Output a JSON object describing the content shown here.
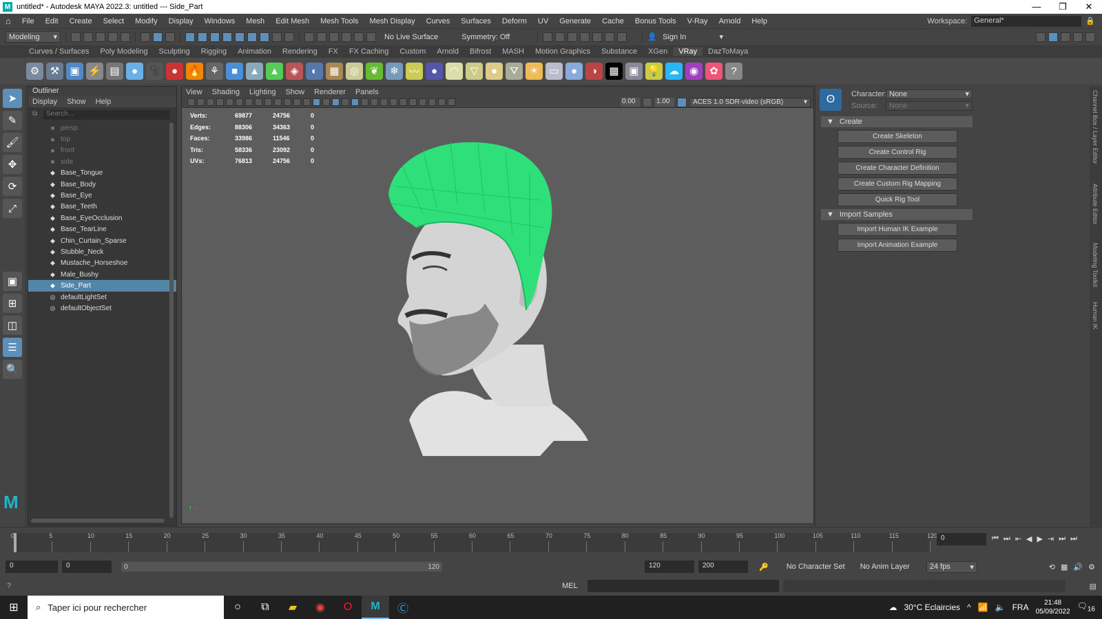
{
  "window": {
    "title": "untitled* - Autodesk MAYA 2022.3: untitled   ---   Side_Part",
    "min": "—",
    "restore": "❐",
    "close": "✕"
  },
  "menu": [
    "File",
    "Edit",
    "Create",
    "Select",
    "Modify",
    "Display",
    "Windows",
    "Mesh",
    "Edit Mesh",
    "Mesh Tools",
    "Mesh Display",
    "Curves",
    "Surfaces",
    "Deform",
    "UV",
    "Generate",
    "Cache",
    "Bonus Tools",
    "V-Ray",
    "Arnold",
    "Help"
  ],
  "workspace": {
    "label": "Workspace:",
    "value": "General*"
  },
  "status": {
    "mode": "Modeling",
    "live_surface": "No Live Surface",
    "symmetry": "Symmetry: Off",
    "signin": "Sign In"
  },
  "shelf_tabs": [
    "Curves / Surfaces",
    "Poly Modeling",
    "Sculpting",
    "Rigging",
    "Animation",
    "Rendering",
    "FX",
    "FX Caching",
    "Custom",
    "Arnold",
    "Bifrost",
    "MASH",
    "Motion Graphics",
    "Substance",
    "XGen",
    "VRay",
    "DazToMaya"
  ],
  "shelf_active": "VRay",
  "outliner": {
    "title": "Outliner",
    "menu": [
      "Display",
      "Show",
      "Help"
    ],
    "search_placeholder": "Search...",
    "items": [
      {
        "label": "persp",
        "type": "camera"
      },
      {
        "label": "top",
        "type": "camera"
      },
      {
        "label": "front",
        "type": "camera"
      },
      {
        "label": "side",
        "type": "camera"
      },
      {
        "label": "Base_Tongue",
        "type": "mesh"
      },
      {
        "label": "Base_Body",
        "type": "mesh"
      },
      {
        "label": "Base_Eye",
        "type": "mesh"
      },
      {
        "label": "Base_Teeth",
        "type": "mesh"
      },
      {
        "label": "Base_EyeOcclusion",
        "type": "mesh"
      },
      {
        "label": "Base_TearLine",
        "type": "mesh"
      },
      {
        "label": "Chin_Curtain_Sparse",
        "type": "mesh"
      },
      {
        "label": "Stubble_Neck",
        "type": "mesh"
      },
      {
        "label": "Mustache_Horseshoe",
        "type": "mesh"
      },
      {
        "label": "Male_Bushy",
        "type": "mesh"
      },
      {
        "label": "Side_Part",
        "type": "mesh",
        "selected": true
      },
      {
        "label": "defaultLightSet",
        "type": "set"
      },
      {
        "label": "defaultObjectSet",
        "type": "set"
      }
    ]
  },
  "viewport": {
    "menu": [
      "View",
      "Shading",
      "Lighting",
      "Show",
      "Renderer",
      "Panels"
    ],
    "exposure": "0.00",
    "gamma": "1.00",
    "colorspace": "ACES 1.0 SDR-video (sRGB)",
    "hud": [
      {
        "k": "Verts:",
        "a": "69877",
        "b": "24756",
        "c": "0"
      },
      {
        "k": "Edges:",
        "a": "88306",
        "b": "34363",
        "c": "0"
      },
      {
        "k": "Faces:",
        "a": "33986",
        "b": "11546",
        "c": "0"
      },
      {
        "k": "Tris:",
        "a": "58336",
        "b": "23092",
        "c": "0"
      },
      {
        "k": "UVs:",
        "a": "76813",
        "b": "24756",
        "c": "0"
      }
    ]
  },
  "hik": {
    "character_label": "Character:",
    "character": "None",
    "source_label": "Source:",
    "source": "None",
    "sections": [
      {
        "title": "Create",
        "buttons": [
          "Create Skeleton",
          "Create Control Rig",
          "Create Character Definition",
          "Create Custom Rig Mapping",
          "Quick Rig Tool"
        ]
      },
      {
        "title": "Import Samples",
        "buttons": [
          "Import Human IK Example",
          "Import Animation Example"
        ]
      }
    ]
  },
  "sidetabs": [
    "Channel Box / Layer Editor",
    "Attribute Editor",
    "Modeling Toolkit",
    "Human IK"
  ],
  "timeline": {
    "ticks": [
      "0",
      "5",
      "10",
      "15",
      "20",
      "25",
      "30",
      "35",
      "40",
      "45",
      "50",
      "55",
      "60",
      "65",
      "70",
      "75",
      "80",
      "85",
      "90",
      "95",
      "100",
      "105",
      "110",
      "115",
      "120"
    ],
    "current": "0"
  },
  "range": {
    "start": "0",
    "inner_start": "0",
    "slider_start": "0",
    "slider_end": "120",
    "end": "120",
    "outer_end": "200",
    "char_set": "No Character Set",
    "anim_layer": "No Anim Layer",
    "fps": "24 fps"
  },
  "cmd": {
    "lang": "MEL"
  },
  "taskbar": {
    "search": "Taper ici pour rechercher",
    "weather": "30°C  Eclaircies",
    "lang": "FRA",
    "time": "21:48",
    "date": "05/09/2022",
    "notif": "16"
  },
  "colors": {
    "hair": "#2fe07a",
    "select": "#5285a6"
  }
}
